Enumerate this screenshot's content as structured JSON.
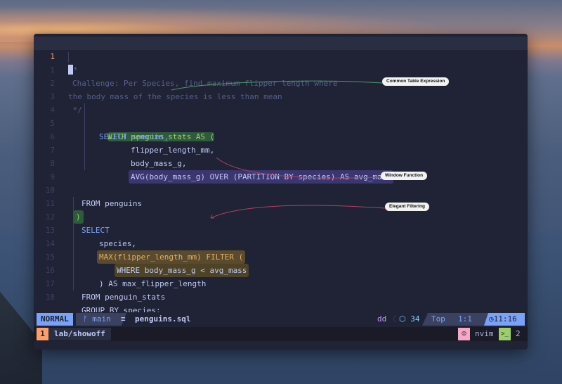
{
  "editor": {
    "lines": [
      {
        "n": "1",
        "text": "*"
      },
      {
        "n": "1",
        "text": "Challenge: Per Species, find maximum flipper length where"
      },
      {
        "n": "2",
        "text": "the body mass of the species is less than mean"
      },
      {
        "n": "3",
        "text": " */"
      },
      {
        "n": "4",
        "text": "WITH penguin_stats AS ("
      },
      {
        "n": "5",
        "text": "SELECT species,"
      },
      {
        "n": "6",
        "text": "flipper_length_mm,"
      },
      {
        "n": "7",
        "text": "body_mass_g,"
      },
      {
        "n": "8",
        "text": "AVG(body_mass_g) OVER (PARTITION BY species) AS avg_mass"
      },
      {
        "n": "9",
        "text": ""
      },
      {
        "n": "10",
        "text": "FROM penguins"
      },
      {
        "n": "11",
        "text": ")"
      },
      {
        "n": "12",
        "text": "SELECT"
      },
      {
        "n": "13",
        "text": "species,"
      },
      {
        "n": "14",
        "text": "MAX(flipper_length_mm) FILTER ("
      },
      {
        "n": "15",
        "text": "WHERE body_mass_g < avg_mass"
      },
      {
        "n": "16",
        "text": ") AS max_flipper_length"
      },
      {
        "n": "17",
        "text": "FROM penguin_stats"
      },
      {
        "n": "18",
        "text": "GROUP BY species;"
      }
    ]
  },
  "annotations": {
    "cte": "Common Table Expression",
    "window": "Window Function",
    "filter": "Elegant Filtering"
  },
  "statusline": {
    "mode": "NORMAL",
    "branch": "main",
    "file_icon": "≡",
    "filename": "penguins.sql",
    "dd": "dd",
    "separator": "〈",
    "package_count": "34",
    "scroll": "Top",
    "position": "1:1",
    "clock": "11:16"
  },
  "tmux": {
    "window_index": "1",
    "session": "lab/showoff",
    "program": "nvim",
    "pane_count": "2"
  },
  "colors": {
    "background": "#1f2335",
    "keyword": "#7aa2f7",
    "comment": "#565f89",
    "mode_bg": "#7aa2f7",
    "tmux_index_bg": "#ff9e64"
  }
}
